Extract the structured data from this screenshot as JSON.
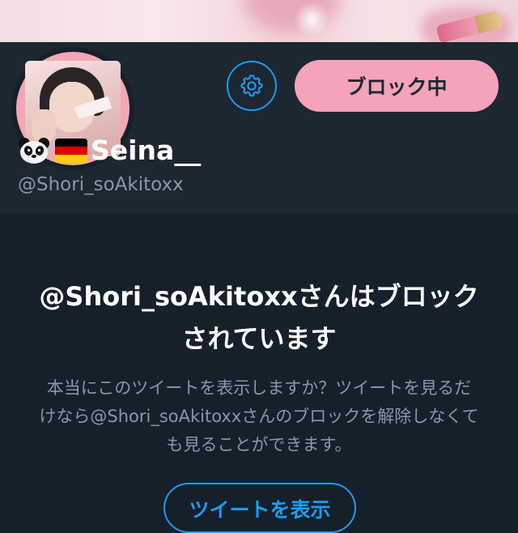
{
  "profile": {
    "display_name": "Seina__",
    "handle": "@Shori_soAkitoxx",
    "emoji_icons": [
      "panda-face-icon",
      "germany-flag-icon"
    ]
  },
  "actions": {
    "block_button_label": "ブロック中",
    "settings_icon": "gear-icon"
  },
  "blocked_notice": {
    "title": "@Shori_soAkitoxxさんはブロックされています",
    "description": "本当にこのツイートを表示しますか？ツイートを見るだけなら@Shori_soAkitoxxさんのブロックを解除しなくても見ることができます。",
    "show_tweet_label": "ツイートを表示"
  },
  "colors": {
    "background": "#15202b",
    "header_bg": "#1c2732",
    "accent_blue": "#1d9bf0",
    "block_pink": "#f4a3b9",
    "muted_text": "#8899a6"
  }
}
